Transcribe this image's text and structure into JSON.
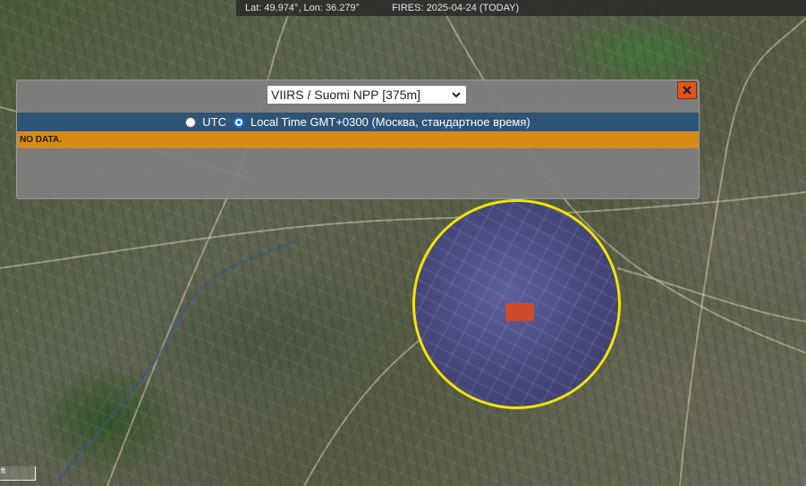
{
  "status": {
    "coords": "Lat: 49.974°, Lon: 36.279°",
    "fires": "FIRES: 2025-04-24 (TODAY)"
  },
  "panel": {
    "sensor": {
      "selected": "VIIRS / Suomi NPP [375m]"
    },
    "close_icon": "close-icon",
    "time_mode": {
      "options": [
        "UTC",
        "Local Time GMT+0300 (Москва, стандартное время)"
      ],
      "selected_index": 1
    },
    "message": "NO DATA."
  },
  "map": {
    "scale_label": "ft",
    "circle_color": "#f4e400",
    "marker_color": "#d2492a"
  },
  "colors": {
    "time_bar": "#2e5477",
    "no_data_bar": "#d78a16",
    "close_button": "#e2541c"
  }
}
